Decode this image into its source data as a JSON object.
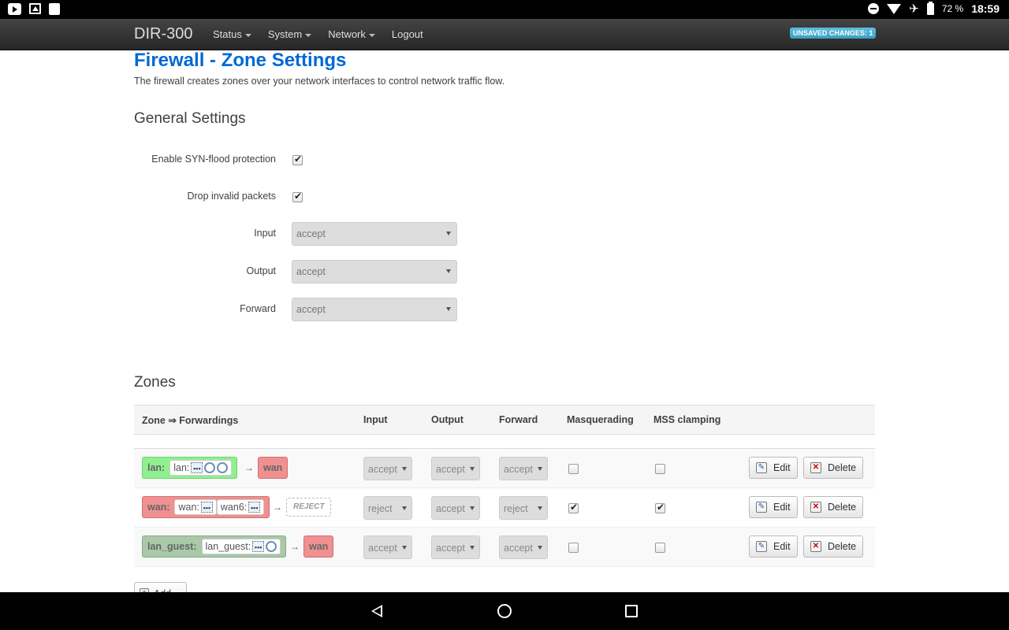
{
  "statusbar": {
    "battery_pct": "72 %",
    "time": "18:59"
  },
  "navbar": {
    "brand": "DIR-300",
    "menu": [
      "Status",
      "System",
      "Network",
      "Logout"
    ],
    "unsaved_badge": "UNSAVED CHANGES: 1"
  },
  "page": {
    "title": "Firewall - Zone Settings",
    "description": "The firewall creates zones over your network interfaces to control network traffic flow."
  },
  "general": {
    "section_title": "General Settings",
    "syn_flood_label": "Enable SYN-flood protection",
    "syn_flood_checked": true,
    "drop_invalid_label": "Drop invalid packets",
    "drop_invalid_checked": true,
    "input_label": "Input",
    "input_value": "accept",
    "output_label": "Output",
    "output_value": "accept",
    "forward_label": "Forward",
    "forward_value": "accept"
  },
  "zones": {
    "section_title": "Zones",
    "columns": {
      "zone": "Zone ⇒ Forwardings",
      "input": "Input",
      "output": "Output",
      "forward": "Forward",
      "masquerading": "Masquerading",
      "mss": "MSS clamping"
    },
    "rows": [
      {
        "zone": "lan:",
        "interfaces": [
          "lan:"
        ],
        "arrow": "→",
        "target": "wan",
        "input": "accept",
        "output": "accept",
        "forward": "accept",
        "masquerading": false,
        "mss": false,
        "edit_label": "Edit",
        "delete_label": "Delete"
      },
      {
        "zone": "wan:",
        "interfaces": [
          "wan:",
          "wan6:"
        ],
        "arrow": "→",
        "target": "REJECT",
        "input": "reject",
        "output": "accept",
        "forward": "reject",
        "masquerading": true,
        "mss": true,
        "edit_label": "Edit",
        "delete_label": "Delete"
      },
      {
        "zone": "lan_guest:",
        "interfaces": [
          "lan_guest:"
        ],
        "arrow": "→",
        "target": "wan",
        "input": "accept",
        "output": "accept",
        "forward": "accept",
        "masquerading": false,
        "mss": false,
        "edit_label": "Edit",
        "delete_label": "Delete"
      }
    ],
    "add_label": "Add"
  },
  "colors": {
    "title_blue": "#0069d6",
    "lan_green": "#90f090",
    "wan_red": "#f09090",
    "guest_green": "#a9c9a9",
    "badge_blue": "#5bc0de"
  }
}
